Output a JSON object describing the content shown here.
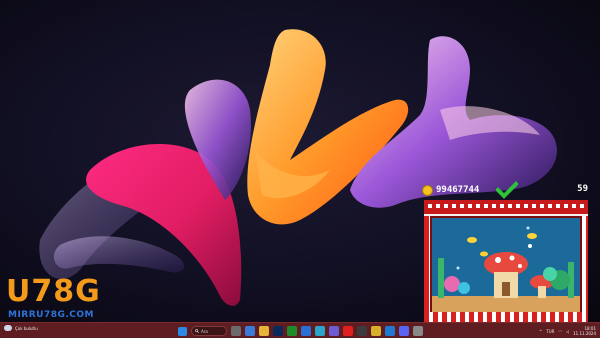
{
  "widget": {
    "coins": "99467744",
    "level": "59"
  },
  "logo": {
    "main": "U78G",
    "url": "MIRRU78G.COM"
  },
  "taskbar": {
    "weather_text": "Çok bulutlu",
    "search_placeholder": "Ara",
    "tray_lang": "TUR",
    "clock_time": "18:01",
    "clock_date": "11.11.2024",
    "icons": [
      "start-icon",
      "search-box",
      "task-view-icon",
      "widgets-icon",
      "file-explorer-icon",
      "photoshop-icon",
      "xbox-icon",
      "store-icon",
      "edge-icon",
      "mail-icon",
      "youtube-icon",
      "app-icon",
      "chrome-icon",
      "vscode-icon",
      "discord-icon",
      "settings-icon"
    ]
  },
  "colors": {
    "taskbar_bg": "#5e1d20",
    "accent_orange": "#f39a1a",
    "accent_blue": "#2e73d8",
    "check_green": "#2fc23a",
    "tank_red": "#d8201f"
  }
}
